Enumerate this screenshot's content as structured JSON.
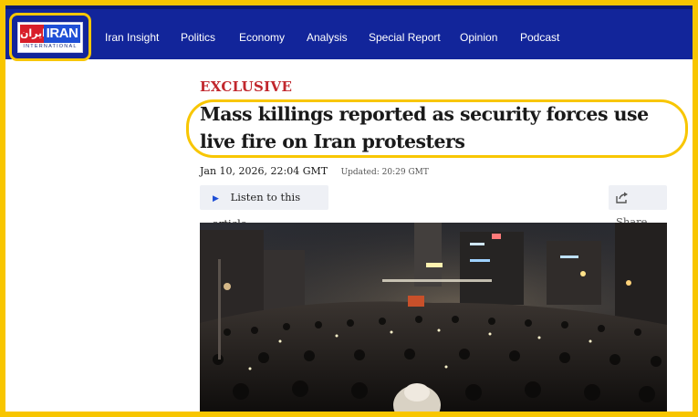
{
  "logo": {
    "persian": "ایران",
    "english": "IRAN",
    "subtitle": "INTERNATIONAL"
  },
  "nav": [
    {
      "label": "Iran Insight"
    },
    {
      "label": "Politics"
    },
    {
      "label": "Economy"
    },
    {
      "label": "Analysis"
    },
    {
      "label": "Special Report"
    },
    {
      "label": "Opinion"
    },
    {
      "label": "Podcast"
    }
  ],
  "article": {
    "kicker": "EXCLUSIVE",
    "headline": "Mass killings reported as security forces use live fire on Iran protesters",
    "date": "Jan 10, 2026, 22:04 GMT",
    "updated": "Updated: 20:29 GMT",
    "listen_label": "Listen to this article",
    "share_label": "Share"
  },
  "colors": {
    "nav_bg": "#12259a",
    "highlight": "#f8c600",
    "kicker": "#c1272d",
    "logo_red": "#d81e2a",
    "logo_blue": "#1f4fd6"
  },
  "icons": {
    "play": "play-icon",
    "share": "share-icon"
  }
}
